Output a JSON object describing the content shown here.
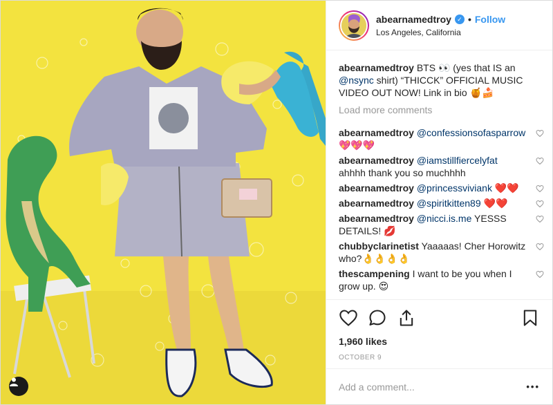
{
  "post": {
    "username": "abearnamedtroy",
    "follow_label": "Follow",
    "location": "Los Angeles, California",
    "caption": {
      "user": "abearnamedtroy",
      "text_1": "BTS 👀 (yes that IS an ",
      "mention": "@nsync",
      "text_2": " shirt) “THICCK” OFFICIAL MUSIC VIDEO OUT NOW! Link in bio 🍯🍰"
    },
    "load_more_label": "Load more comments",
    "comments": [
      {
        "user": "abearnamedtroy",
        "mention": "@confessionsofasparrow",
        "text": " 💖💖💖"
      },
      {
        "user": "abearnamedtroy",
        "mention": "@iamstillfiercelyfat",
        "text": " ahhhh thank you so muchhhh"
      },
      {
        "user": "abearnamedtroy",
        "mention": "@princessviviank",
        "text": " ❤️❤️"
      },
      {
        "user": "abearnamedtroy",
        "mention": "@spiritkitten89",
        "text": " ❤️❤️"
      },
      {
        "user": "abearnamedtroy",
        "mention": "@nicci.is.me",
        "text": " YESSS DETAILS! 💋"
      },
      {
        "user": "chubbyclarinetist",
        "mention": "",
        "text": "Yaaaaas! Cher Horowitz who?👌👌👌👌"
      },
      {
        "user": "thescampening",
        "mention": "",
        "text": "I want to be you when I grow up. 😍"
      }
    ],
    "likes": "1,960 likes",
    "date": "OCTOBER 9",
    "comment_placeholder": "Add a comment...",
    "more_label": "•••"
  },
  "icons": {
    "like": "heart-icon",
    "comment": "comment-icon",
    "share": "share-icon",
    "save": "bookmark-icon",
    "verified": "verified-badge-icon",
    "tag": "user-tag-icon"
  },
  "colors": {
    "accent": "#3897f0",
    "photo_background": "#f2e13a"
  }
}
